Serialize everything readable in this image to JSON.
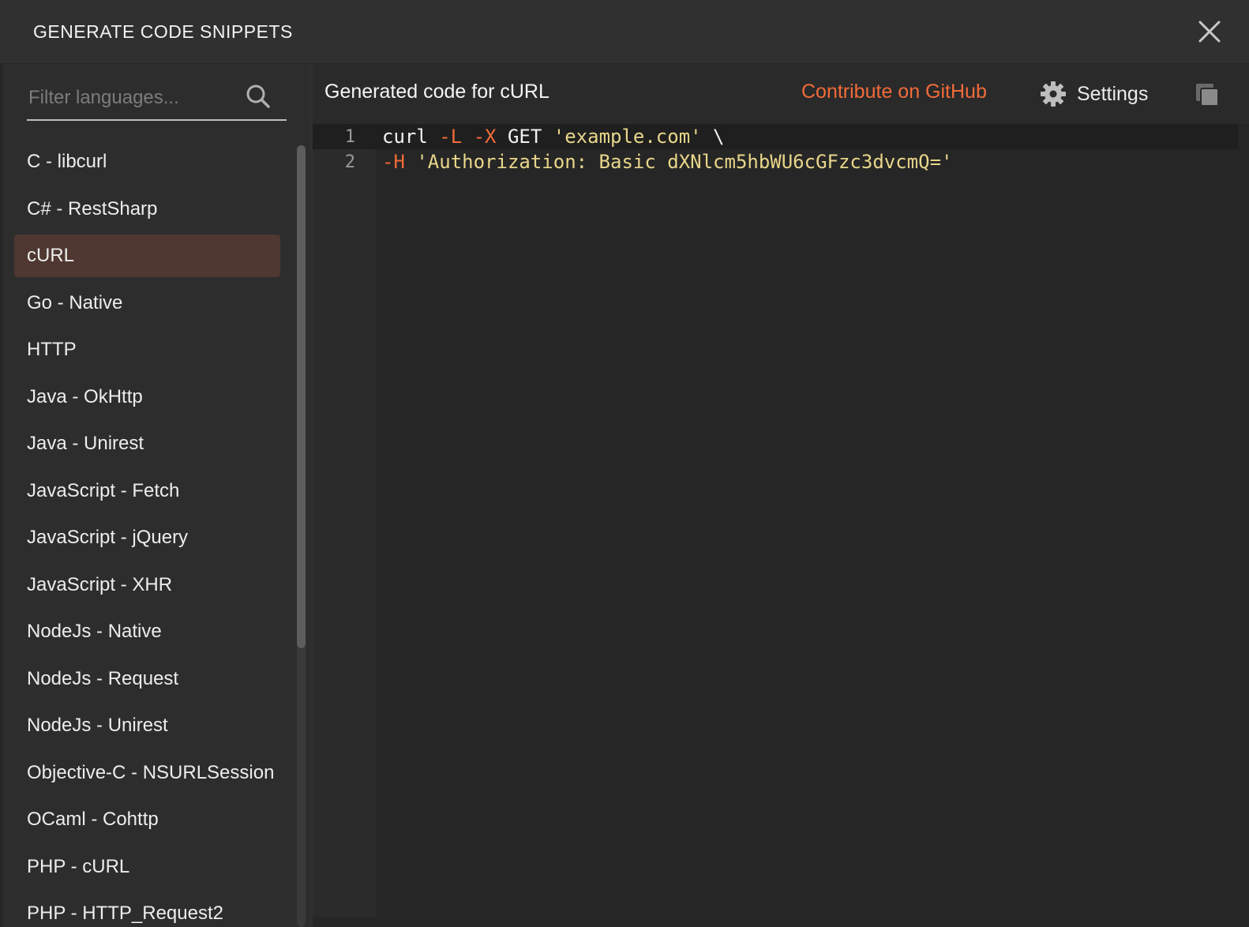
{
  "header": {
    "title": "GENERATE CODE SNIPPETS"
  },
  "sidebar": {
    "search_placeholder": "Filter languages...",
    "languages": [
      "C - libcurl",
      "C# - RestSharp",
      "cURL",
      "Go - Native",
      "HTTP",
      "Java - OkHttp",
      "Java - Unirest",
      "JavaScript - Fetch",
      "JavaScript - jQuery",
      "JavaScript - XHR",
      "NodeJs - Native",
      "NodeJs - Request",
      "NodeJs - Unirest",
      "Objective-C - NSURLSession",
      "OCaml - Cohttp",
      "PHP - cURL",
      "PHP - HTTP_Request2"
    ],
    "selected": "cURL"
  },
  "main": {
    "title": "Generated code for cURL",
    "github_link": "Contribute on GitHub",
    "settings_label": "Settings"
  },
  "code": {
    "lines": [
      {
        "number": "1",
        "cmd": "curl ",
        "flag1": "-L",
        "sp1": " ",
        "flag2": "-X",
        "rest": " GET ",
        "str": "'example.com'",
        "tail": " \\"
      },
      {
        "number": "2",
        "flag1": "-H",
        "sp1": " ",
        "str": "'Authorization: Basic dXNlcm5hbWU6cGFzc3dvcmQ='"
      }
    ]
  },
  "colors": {
    "accent": "#f26b3a",
    "selected_bg": "#4f3832",
    "string": "#e8d68a"
  }
}
